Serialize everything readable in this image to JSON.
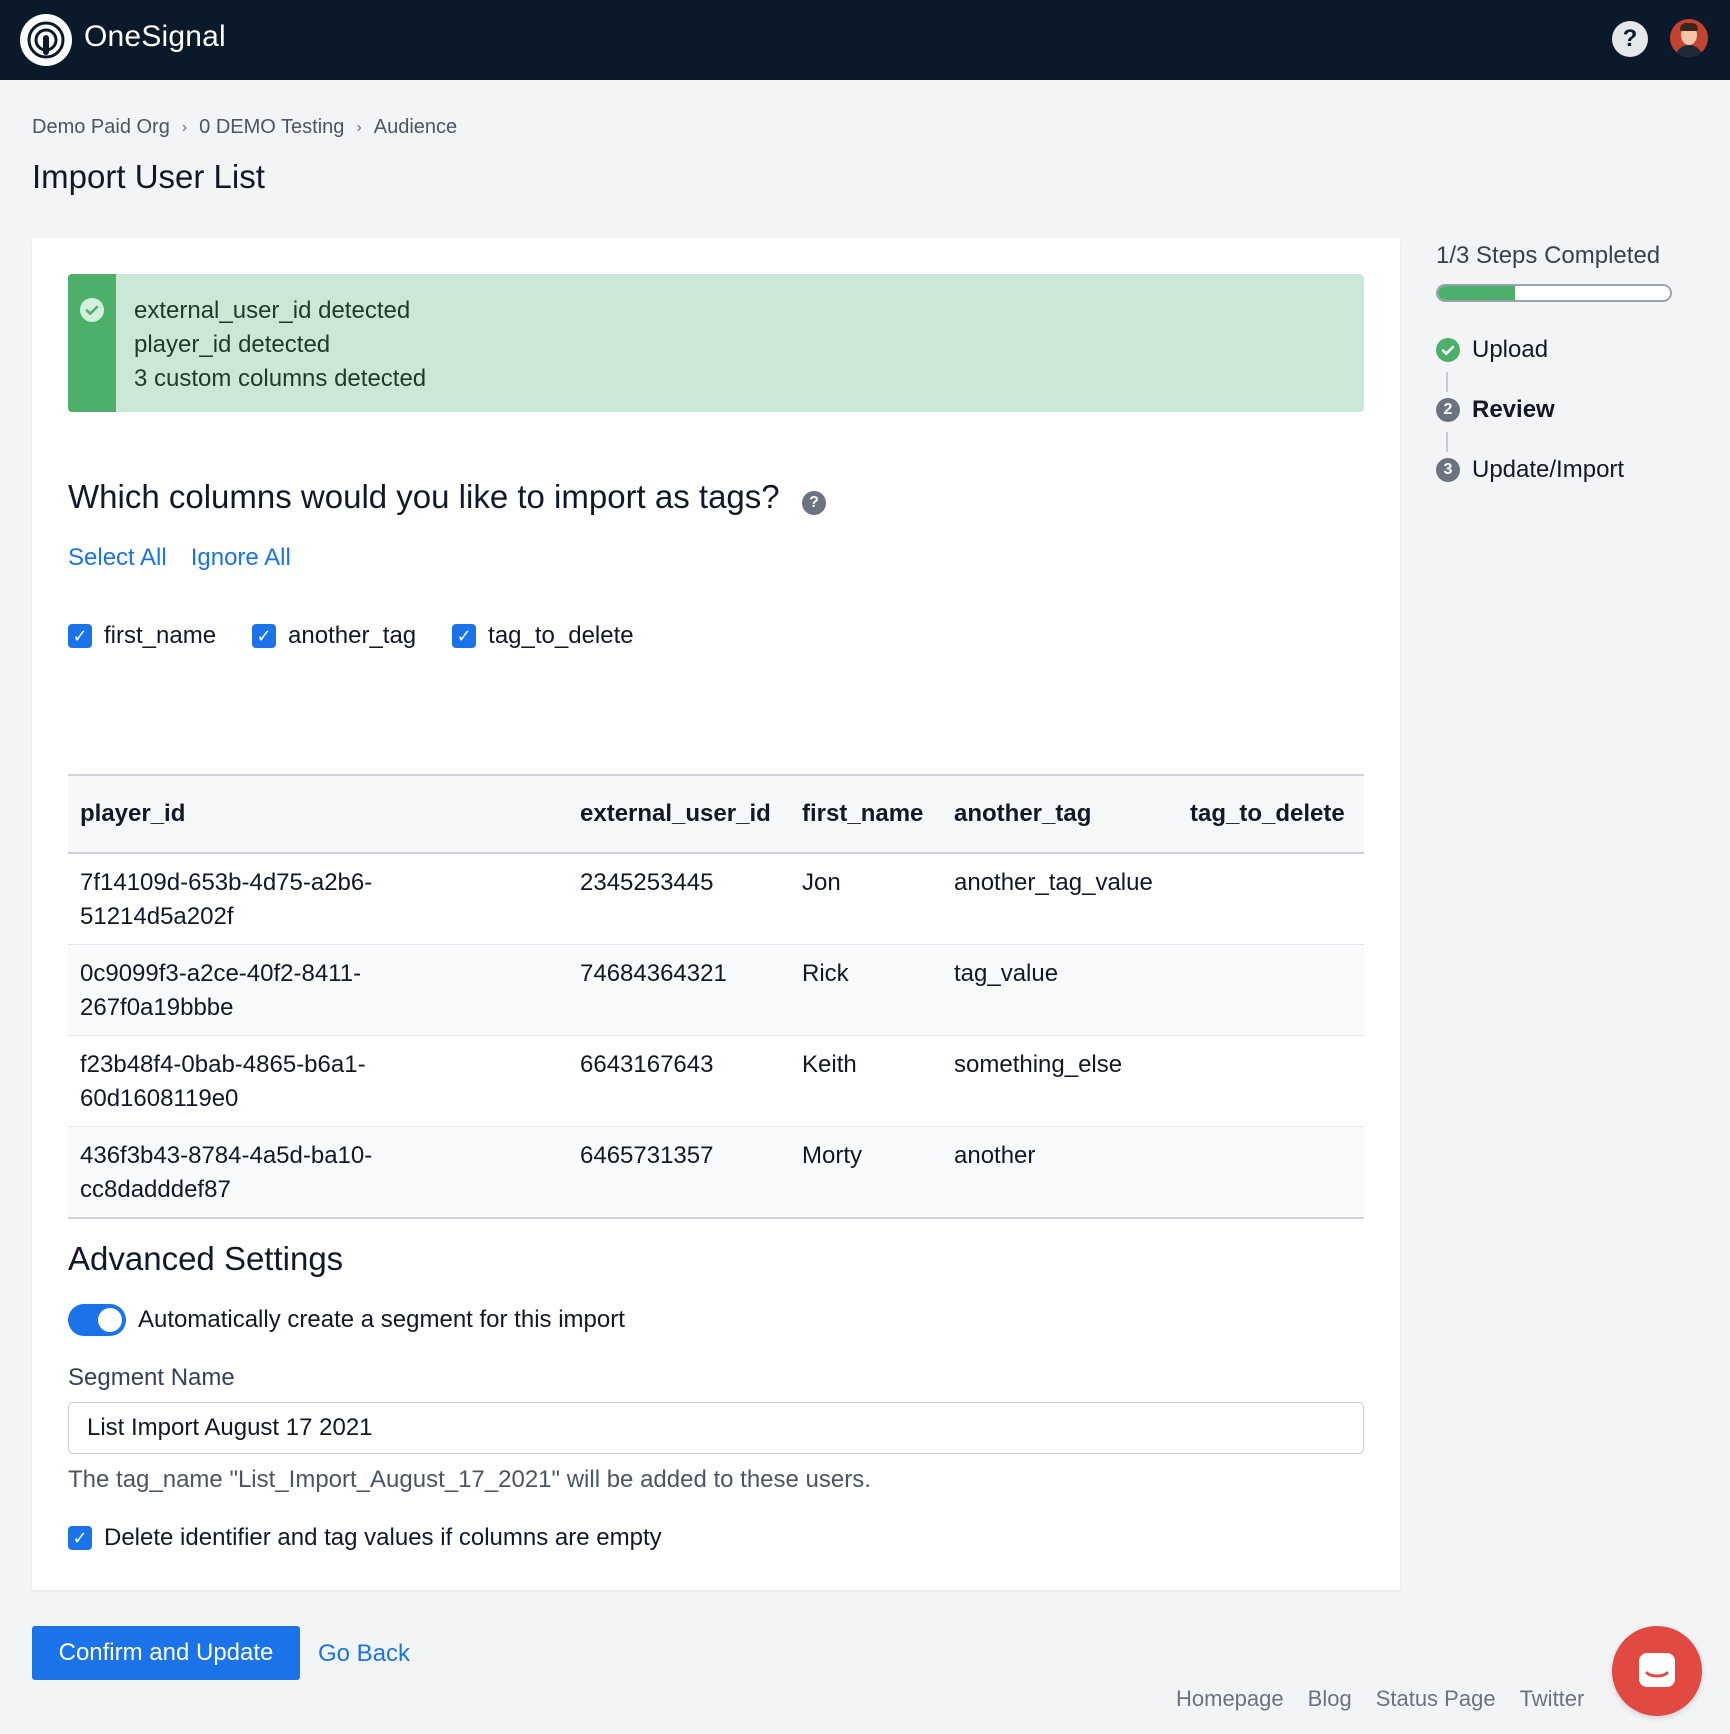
{
  "app": {
    "name_part1": "One",
    "name_part2": "Signal"
  },
  "header": {
    "help_icon_glyph": "?"
  },
  "breadcrumb": {
    "items": [
      "Demo Paid Org",
      "0 DEMO Testing",
      "Audience"
    ],
    "separator": "›"
  },
  "page": {
    "title": "Import User List"
  },
  "alert": {
    "lines": [
      "external_user_id detected",
      "player_id detected",
      "3 custom columns detected"
    ]
  },
  "columns_section": {
    "heading": "Which columns would you like to import as tags?",
    "select_all": "Select All",
    "ignore_all": "Ignore All",
    "tag_options": [
      {
        "label": "first_name",
        "checked": true
      },
      {
        "label": "another_tag",
        "checked": true
      },
      {
        "label": "tag_to_delete",
        "checked": true
      }
    ]
  },
  "table": {
    "headers": [
      "player_id",
      "external_user_id",
      "first_name",
      "another_tag",
      "tag_to_delete"
    ],
    "rows": [
      {
        "player_id_line1": "7f14109d-653b-4d75-a2b6-",
        "player_id_line2": "51214d5a202f",
        "external_user_id": "2345253445",
        "first_name": "Jon",
        "another_tag": "another_tag_value",
        "tag_to_delete": ""
      },
      {
        "player_id_line1": "0c9099f3-a2ce-40f2-8411-",
        "player_id_line2": "267f0a19bbbe",
        "external_user_id": "74684364321",
        "first_name": "Rick",
        "another_tag": "tag_value",
        "tag_to_delete": ""
      },
      {
        "player_id_line1": "f23b48f4-0bab-4865-b6a1-",
        "player_id_line2": "60d1608119e0",
        "external_user_id": "6643167643",
        "first_name": "Keith",
        "another_tag": "something_else",
        "tag_to_delete": ""
      },
      {
        "player_id_line1": "436f3b43-8784-4a5d-ba10-",
        "player_id_line2": "cc8dadddef87",
        "external_user_id": "6465731357",
        "first_name": "Morty",
        "another_tag": "another",
        "tag_to_delete": ""
      }
    ]
  },
  "advanced": {
    "title": "Advanced Settings",
    "auto_segment_label": "Automatically create a segment for this import",
    "auto_segment_enabled": true,
    "segment_name_label": "Segment Name",
    "segment_name_value": "List Import August 17 2021",
    "tag_help": "The tag_name \"List_Import_August_17_2021\" will be added to these users.",
    "delete_empty_label": "Delete identifier and tag values if columns are empty",
    "delete_empty_checked": true
  },
  "actions": {
    "confirm": "Confirm and Update",
    "back": "Go Back"
  },
  "steps": {
    "completed_text": "1/3 Steps Completed",
    "progress_fraction": 0.333,
    "items": [
      {
        "label": "Upload",
        "marker": "",
        "state": "done"
      },
      {
        "label": "Review",
        "marker": "2",
        "state": "current"
      },
      {
        "label": "Update/Import",
        "marker": "3",
        "state": "pending"
      }
    ]
  },
  "footer": {
    "links": [
      "Homepage",
      "Blog",
      "Status Page",
      "Twitter"
    ]
  },
  "colors": {
    "brand_dark": "#0b1a2b",
    "accent_blue": "#1a73e8",
    "success_green": "#4caf6a",
    "chat_red": "#e14a43"
  }
}
